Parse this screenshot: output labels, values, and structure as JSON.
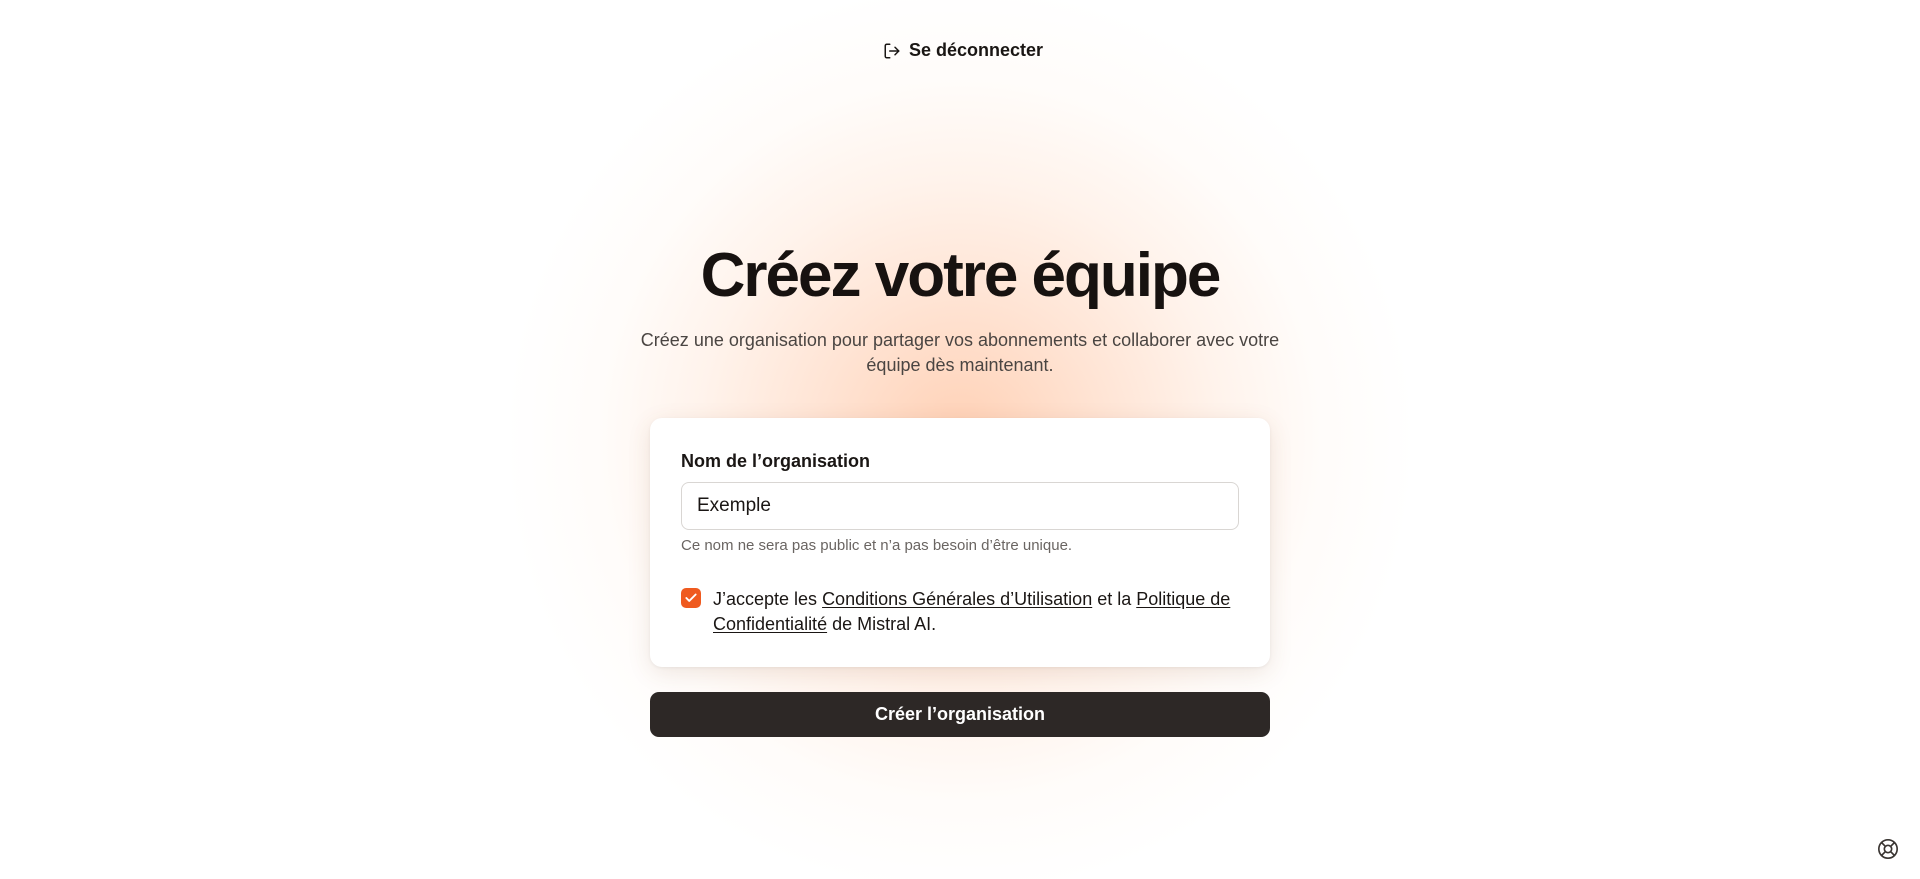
{
  "header": {
    "logout_label": "Se déconnecter",
    "logout_icon": "log-out-icon"
  },
  "hero": {
    "title": "Créez votre équipe",
    "subtitle": "Créez une organisation pour partager vos abonnements et collaborer avec votre équipe dès maintenant."
  },
  "form": {
    "name_label": "Nom de l’organisation",
    "name_value": "Exemple",
    "name_hint": "Ce nom ne sera pas public et n’a pas besoin d’être unique.",
    "consent": {
      "checked": true,
      "text_before": "J’accepte les ",
      "terms_link": "Conditions Générales d’Utilisation",
      "text_middle": " et la ",
      "privacy_link": "Politique de Confidentialité",
      "text_after": " de Mistral AI."
    },
    "submit_label": "Créer l’organisation"
  },
  "help": {
    "icon": "lifebuoy-icon"
  },
  "colors": {
    "accent": "#ef5a1f",
    "button_bg": "#2d2826",
    "glow": "#ffb482"
  }
}
